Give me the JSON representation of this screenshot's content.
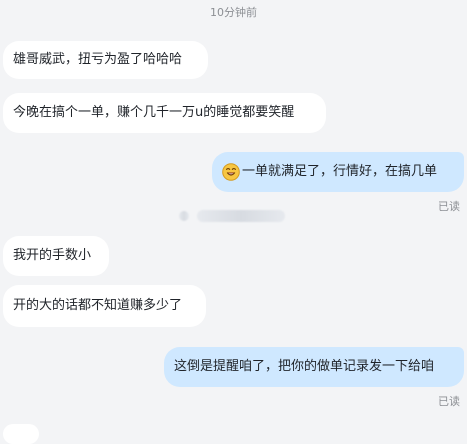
{
  "chat": {
    "timestamp": "10分钟前",
    "messages": [
      {
        "side": "in",
        "text": "雄哥威武，扭亏为盈了哈哈哈"
      },
      {
        "side": "in",
        "text": "今晚在搞个一单，赚个几千一万u的睡觉都要笑醒"
      },
      {
        "side": "out",
        "text": "一单就满足了，行情好，在搞几单",
        "emoji": "smiling-face-icon",
        "status": "已读"
      },
      {
        "side": "in",
        "text": "我开的手数小"
      },
      {
        "side": "in",
        "text": "开的大的话都不知道赚多少了"
      },
      {
        "side": "out",
        "text": "这倒是提醒咱了，把你的做单记录发一下给咱",
        "status": "已读"
      }
    ]
  },
  "colors": {
    "background": "#f3f4f6",
    "incoming_bubble": "#ffffff",
    "outgoing_bubble": "#cfe8ff",
    "meta_text": "#8c8f94"
  }
}
